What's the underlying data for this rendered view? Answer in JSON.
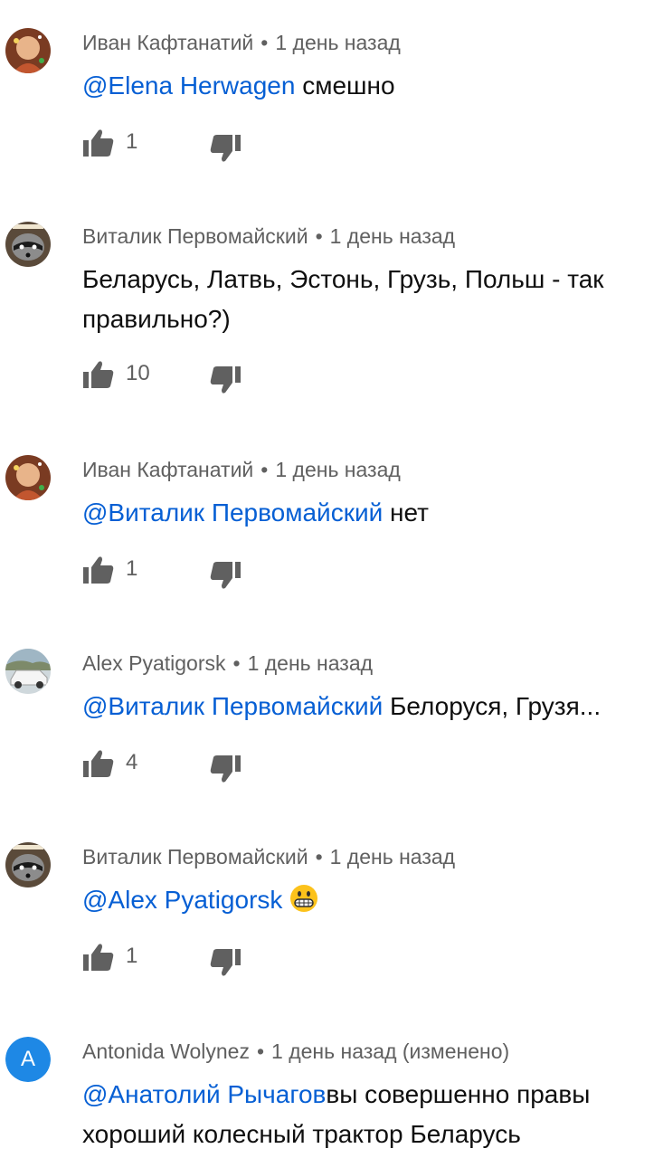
{
  "comments": [
    {
      "author": "Иван Кафтанатий",
      "time": "1 день назад",
      "mention": "@Elena Herwagen",
      "text": " смешно",
      "likes": "1"
    },
    {
      "author": "Виталик Первомайский",
      "time": "1 день назад",
      "mention": "",
      "text": "Беларусь, Латвь, Эстонь, Грузь, Польш - так правильно?)",
      "likes": "10"
    },
    {
      "author": "Иван Кафтанатий",
      "time": "1 день назад",
      "mention": "@Виталик Первомайский",
      "text": " нет",
      "likes": "1"
    },
    {
      "author": "Alex Pyatigorsk",
      "time": "1 день назад",
      "mention": "@Виталик Первомайский",
      "text": " Белоруся, Грузя...",
      "likes": "4"
    },
    {
      "author": "Виталик Первомайский",
      "time": "1 день назад",
      "mention": "@Alex Pyatigorsk",
      "text": "",
      "emoji": "grinning-face-emoji",
      "likes": "1"
    },
    {
      "author": "Antonida Wolynez",
      "time": "1 день назад (изменено)",
      "avatar_letter": "A",
      "mention": "@Анатолий Рычагов",
      "text": "вы совершенно правы хороший колесный трактор Беларусь"
    }
  ],
  "separator": "•",
  "icons": {
    "like": "thumbs-up-icon",
    "dislike": "thumbs-down-icon"
  },
  "colors": {
    "mention": "#065fd4",
    "meta": "#606060",
    "text": "#0f0f0f",
    "avatar_letter_bg": "#1e88e5"
  }
}
